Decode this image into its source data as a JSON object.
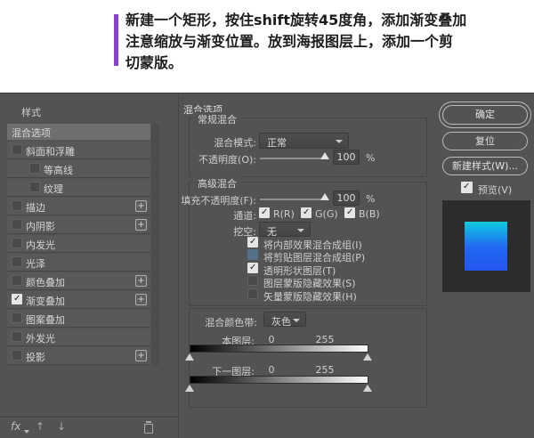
{
  "instruction": {
    "accent_color": "#8d3fd4",
    "lines": [
      "新建一个矩形，按住shift旋转45度角，添加渐变叠加",
      "注意缩放与渐变位置。放到海报图层上，添加一个剪",
      "切蒙版。"
    ]
  },
  "dialog": {
    "styles_panel": {
      "title": "样式",
      "selected_item": "混合选项",
      "items": [
        {
          "label": "斜面和浮雕",
          "state": "unchecked"
        },
        {
          "label": "等高线",
          "state": "unchecked"
        },
        {
          "label": "纹理",
          "state": "unchecked"
        },
        {
          "label": "描边",
          "state": "unchecked"
        },
        {
          "label": "内阴影",
          "state": "unchecked"
        },
        {
          "label": "内发光",
          "state": "unchecked"
        },
        {
          "label": "光泽",
          "state": "unchecked"
        },
        {
          "label": "颜色叠加",
          "state": "unchecked"
        },
        {
          "label": "渐变叠加",
          "state": "checked"
        },
        {
          "label": "图案叠加",
          "state": "unchecked"
        },
        {
          "label": "外发光",
          "state": "unchecked"
        },
        {
          "label": "投影",
          "state": "unchecked"
        }
      ],
      "fx_label": "fx"
    },
    "main": {
      "title": "混合选项",
      "general": {
        "legend": "常规混合",
        "blend_mode_label": "混合模式:",
        "blend_mode_value": "正常",
        "opacity_label": "不透明度(O):",
        "opacity_value": "100",
        "opacity_unit": "%"
      },
      "advanced": {
        "legend": "高级混合",
        "fill_opacity_label": "填充不透明度(F):",
        "fill_opacity_value": "100",
        "fill_opacity_unit": "%",
        "channels_label": "通道:",
        "channels": [
          {
            "label": "R(R)",
            "state": "checked"
          },
          {
            "label": "G(G)",
            "state": "checked"
          },
          {
            "label": "B(B)",
            "state": "checked"
          }
        ],
        "knockout_label": "挖空:",
        "knockout_value": "无",
        "options": [
          {
            "label": "将内部效果混合成组(I)",
            "state": "checked"
          },
          {
            "label": "将剪贴图层混合成组(P)",
            "state": "blue"
          },
          {
            "label": "透明形状图层(T)",
            "state": "checked"
          },
          {
            "label": "图层蒙版隐藏效果(S)",
            "state": "unchecked"
          },
          {
            "label": "矢量蒙版隐藏效果(H)",
            "state": "unchecked"
          }
        ]
      },
      "blend_if": {
        "band_label": "混合颜色带:",
        "band_value": "灰色",
        "this_layer_label": "本图层:",
        "this_layer_min": "0",
        "this_layer_max": "255",
        "underlying_label": "下一图层:",
        "underlying_min": "0",
        "underlying_max": "255"
      }
    },
    "actions": {
      "ok": "确定",
      "reset": "复位",
      "new_style": "新建样式(W)...",
      "preview_label": "预览(V)",
      "preview_state": "checked"
    },
    "preview_colors": {
      "top": "#10cade",
      "bottom": "#2355ee"
    }
  }
}
